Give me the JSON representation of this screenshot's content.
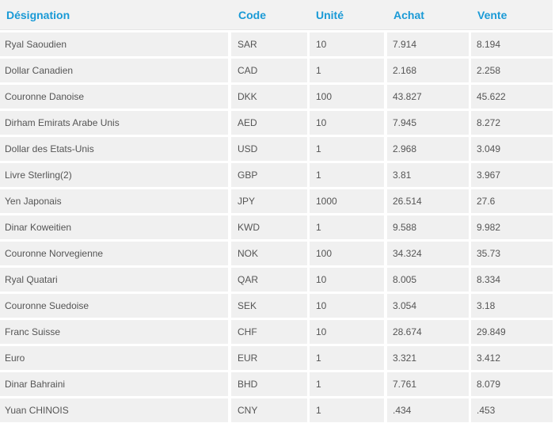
{
  "table": {
    "headers": [
      "Désignation",
      "Code",
      "Unité",
      "Achat",
      "Vente"
    ],
    "rows": [
      [
        "Ryal Saoudien",
        "SAR",
        "10",
        "7.914",
        "8.194"
      ],
      [
        "Dollar Canadien",
        "CAD",
        "1",
        "2.168",
        "2.258"
      ],
      [
        "Couronne Danoise",
        "DKK",
        "100",
        "43.827",
        "45.622"
      ],
      [
        "Dirham Emirats Arabe Unis",
        "AED",
        "10",
        "7.945",
        "8.272"
      ],
      [
        "Dollar des Etats-Unis",
        "USD",
        "1",
        "2.968",
        "3.049"
      ],
      [
        "Livre Sterling(2)",
        "GBP",
        "1",
        "3.81",
        "3.967"
      ],
      [
        "Yen Japonais",
        "JPY",
        "1000",
        "26.514",
        "27.6"
      ],
      [
        "Dinar Koweitien",
        "KWD",
        "1",
        "9.588",
        "9.982"
      ],
      [
        "Couronne Norvegienne",
        "NOK",
        "100",
        "34.324",
        "35.73"
      ],
      [
        "Ryal Quatari",
        "QAR",
        "10",
        "8.005",
        "8.334"
      ],
      [
        "Couronne Suedoise",
        "SEK",
        "10",
        "3.054",
        "3.18"
      ],
      [
        "Franc Suisse",
        "CHF",
        "10",
        "28.674",
        "29.849"
      ],
      [
        "Euro",
        "EUR",
        "1",
        "3.321",
        "3.412"
      ],
      [
        "Dinar Bahraini",
        "BHD",
        "1",
        "7.761",
        "8.079"
      ],
      [
        "Yuan CHINOIS",
        "CNY",
        "1",
        ".434",
        ".453"
      ]
    ]
  }
}
